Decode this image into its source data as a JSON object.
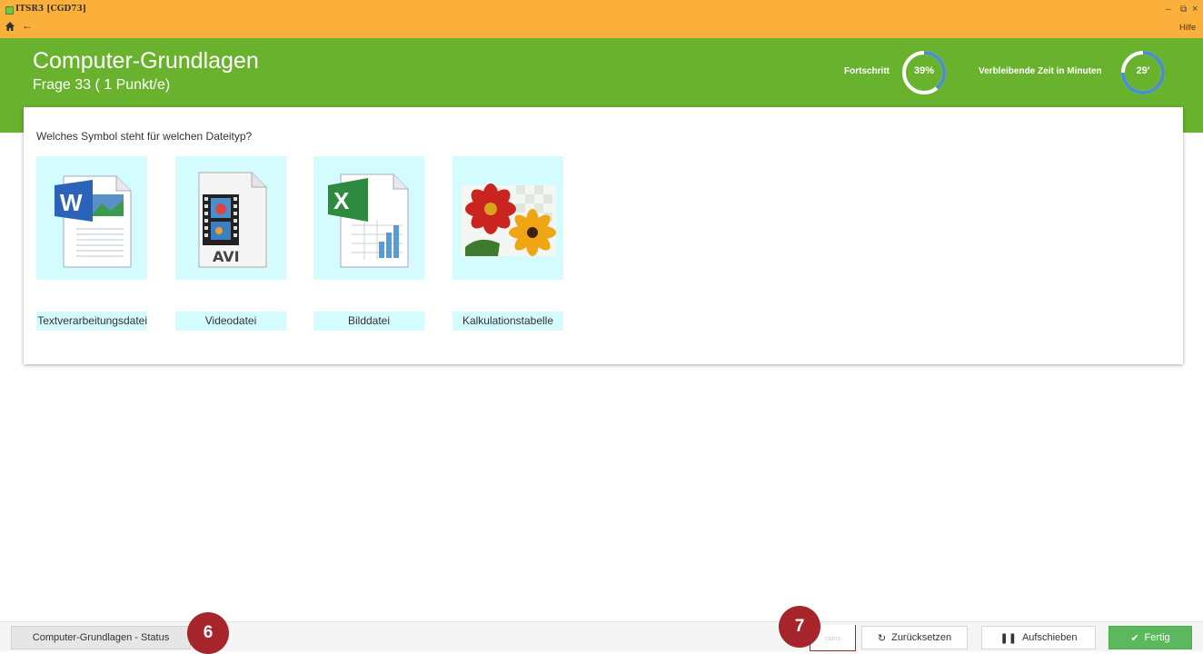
{
  "window": {
    "title": "ITSR3 [CGD73]",
    "help": "Hilfe",
    "min_glyph": "–",
    "max_glyph": "⧉",
    "close_glyph": "×",
    "back_glyph": "←"
  },
  "header": {
    "course_title": "Computer-Grundlagen",
    "question_subtitle": "Frage 33 ( 1 Punkt/e)",
    "progress_label": "Fortschritt",
    "progress_value": "39%",
    "progress_fraction": 0.39,
    "time_label": "Verbleibende Zeit in Minuten",
    "time_value": "29'",
    "time_fraction": 0.75
  },
  "question": {
    "text": "Welches Symbol steht für welchen Dateityp?",
    "icons": [
      "word-document-icon",
      "avi-video-icon",
      "excel-spreadsheet-icon",
      "flower-image-icon"
    ],
    "avi_text": "AVI",
    "labels": [
      "Textverarbeitungsdatei",
      "Videodatei",
      "Bilddatei",
      "Kalkulationstabelle"
    ]
  },
  "footer": {
    "status_button": "Computer-Grundlagen - Status",
    "marker_6": "6",
    "marker_7": "7",
    "code": "CGD73",
    "reset_button": "Zurücksetzen",
    "postpone_button": "Aufschieben",
    "done_button": "Fertig"
  },
  "colors": {
    "titlebar": "#fbb03b",
    "header": "#69b22e",
    "tile": "#d4fbfd",
    "marker": "#a5252b",
    "done": "#5cb85c"
  }
}
